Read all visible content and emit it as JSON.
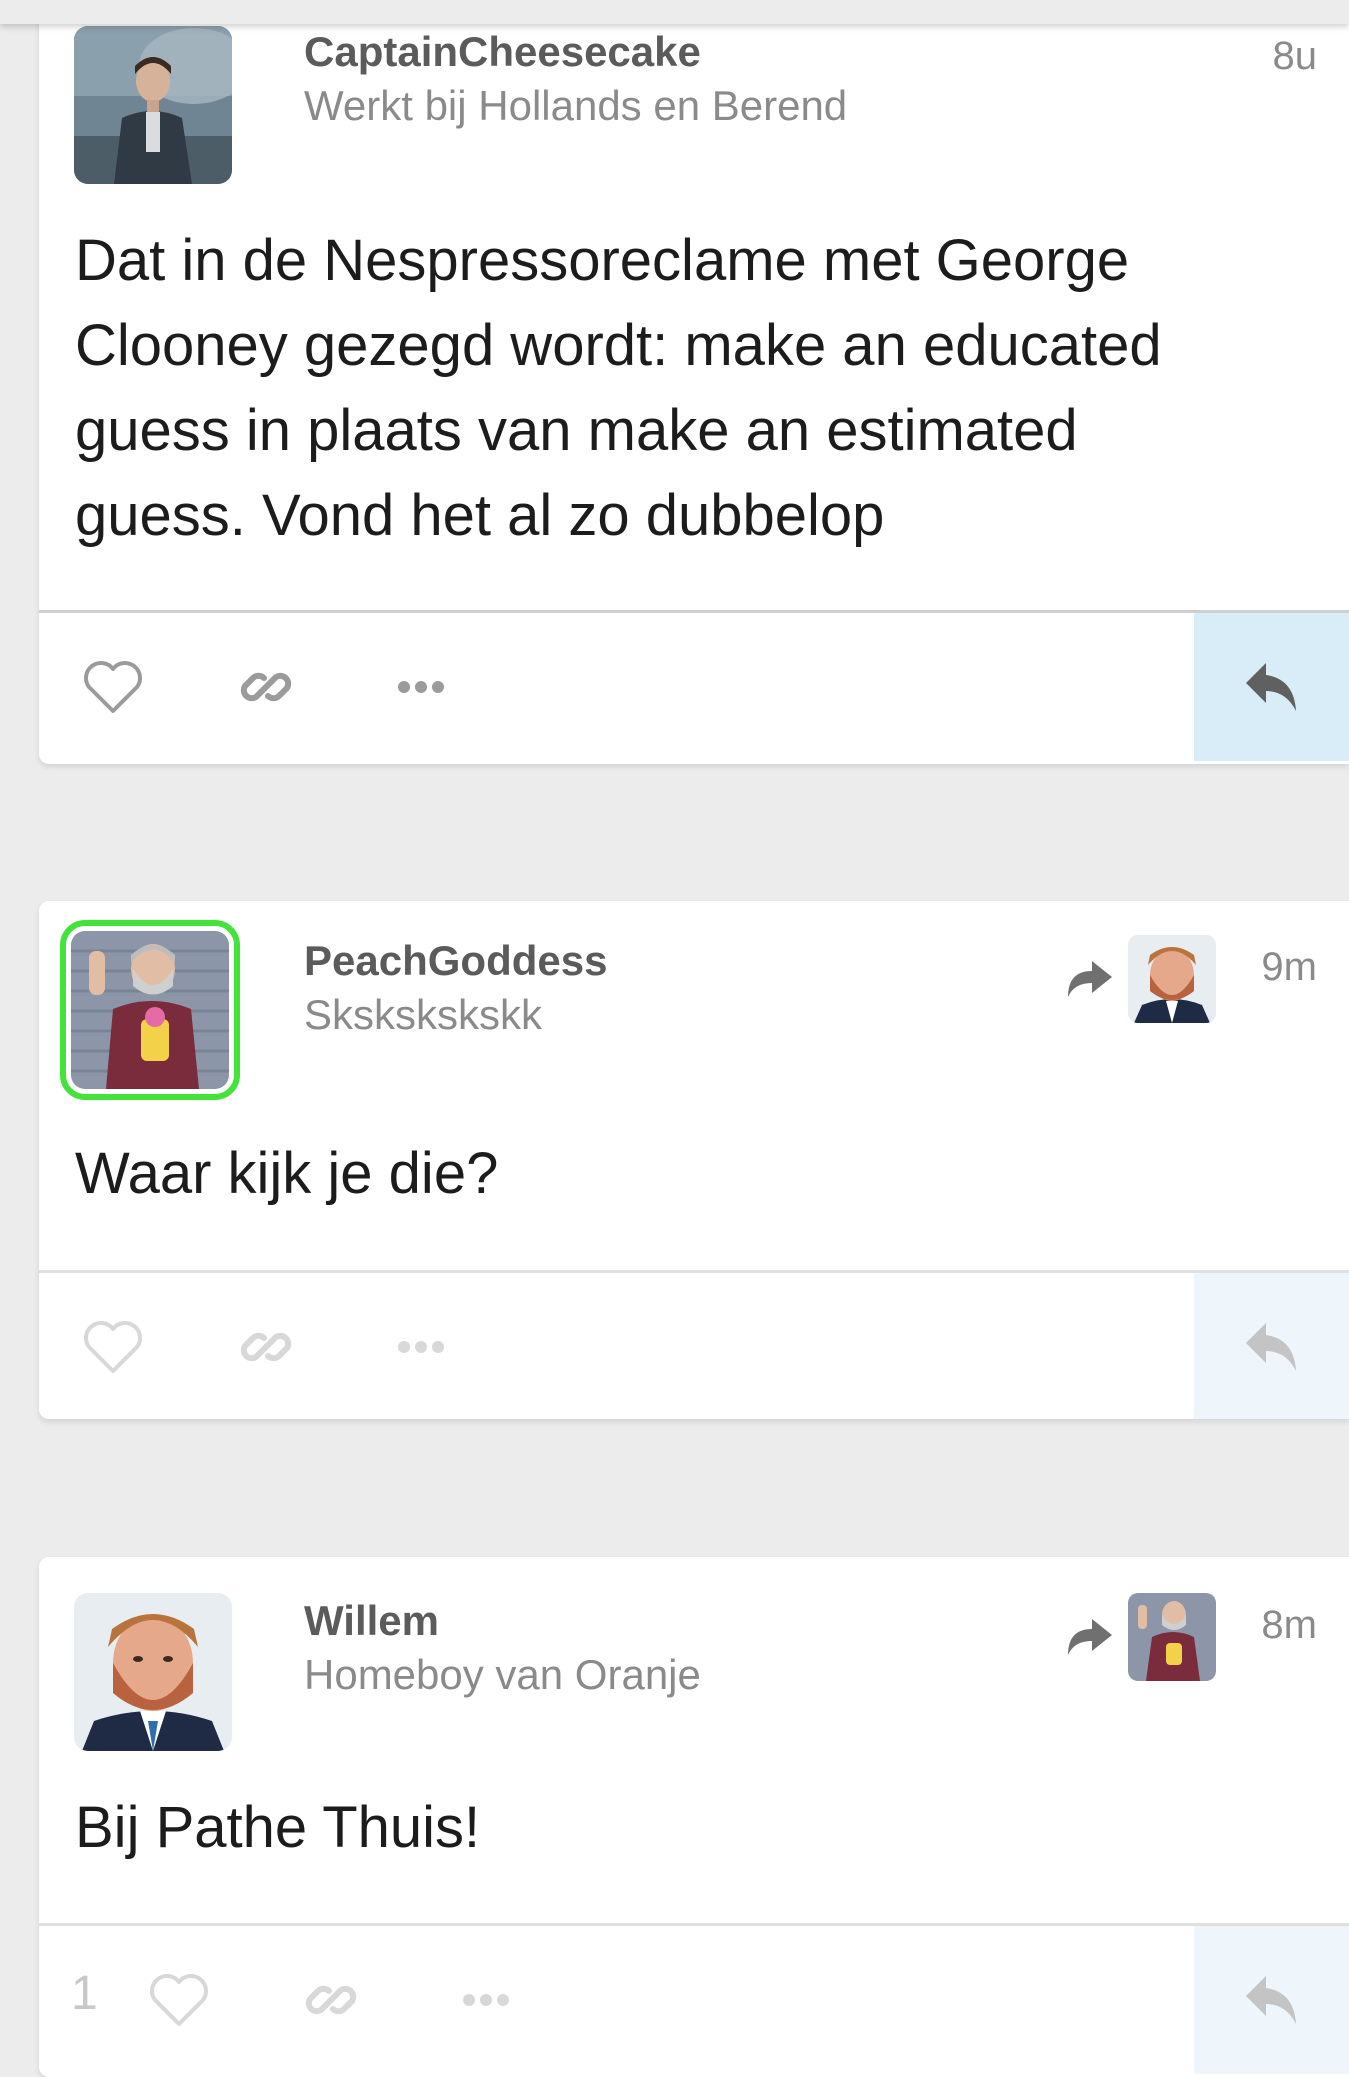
{
  "posts": [
    {
      "username": "CaptainCheesecake",
      "tagline": "Werkt bij Hollands en Berend",
      "time": "8u",
      "text": "Dat in de Nespressoreclame met George Clooney gezegd wordt: make an educated guess in plaats van make an estimated guess. Vond het al zo dubbelop",
      "avatar": "man-in-coat-avatar",
      "reblogged": false
    },
    {
      "username": "PeachGoddess",
      "tagline": "Skskskskskk",
      "time": "9m",
      "text": "Waar kijk je die?",
      "avatar": "man-waving-avatar",
      "online": true,
      "reblogged": true,
      "reblog_avatar": "bearded-man-suit-avatar"
    },
    {
      "username": "Willem",
      "tagline": "Homeboy van Oranje",
      "time": "8m",
      "text": "Bij Pathe Thuis!",
      "avatar": "bearded-man-suit-avatar",
      "reblogged": true,
      "reblog_avatar": "man-waving-avatar",
      "like_count": "1"
    }
  ],
  "icons": {
    "like": "heart-icon",
    "link": "link-icon",
    "more": "more-dots-icon",
    "reply": "reply-arrow-icon",
    "reblog": "reblog-arrow-icon"
  },
  "colors": {
    "background": "#ececec",
    "card": "#ffffff",
    "online_ring": "#44e33a",
    "reply_highlight": "#d8edf8",
    "text": "#1c1c1c",
    "username": "#5b5b5b",
    "muted": "#8a8a8a"
  }
}
